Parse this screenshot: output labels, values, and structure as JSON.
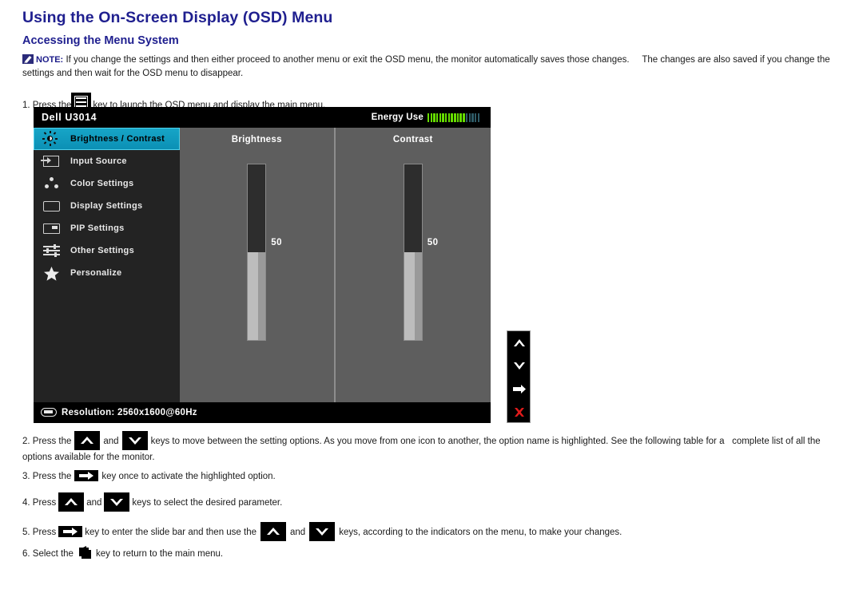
{
  "page": {
    "title": "Using the On-Screen Display (OSD) Menu",
    "subtitle": "Accessing the Menu System"
  },
  "note": {
    "icon": "note-pencil-icon",
    "label": "NOTE:",
    "text_part1": "If you change the settings and then either proceed to another menu or exit the OSD menu, the monitor automatically saves those changes.",
    "text_part2": "The changes are also saved if you change the",
    "text_line2": "settings and then wait for the OSD menu to disappear."
  },
  "steps": [
    {
      "number": "1.",
      "before": "Press the",
      "key": "menu-key-icon",
      "after": "key to launch the OSD menu and display the main menu."
    },
    {
      "number": "2.",
      "before": "Press the",
      "key1": "up-arrow-key-icon",
      "mid": "and",
      "key2": "down-arrow-key-icon",
      "after": "keys to move between the setting options. As you move from one icon to another, the option name is highlighted. See the following table for a",
      "after2": "complete list of all the",
      "line2": "options available for the monitor."
    },
    {
      "number": "3.",
      "before": "Press the",
      "key": "right-arrow-key-icon",
      "after": "key once to activate the highlighted option."
    },
    {
      "number": "4.",
      "before": "Press",
      "key1": "up-arrow-key-icon",
      "mid": "and",
      "key2": "down-arrow-key-icon",
      "after": "keys to select the desired parameter."
    },
    {
      "number": "5.",
      "before": "Press",
      "key1": "right-arrow-key-icon",
      "mid1": "key to enter the slide bar and then use the",
      "key2": "up-arrow-key-icon",
      "mid2": "and",
      "key3": "down-arrow-key-icon",
      "after": "keys, according to the indicators on the menu, to make your changes."
    },
    {
      "number": "6.",
      "before": "Select the",
      "key": "back-key-icon",
      "after": "key to return to the main menu."
    }
  ],
  "osd": {
    "model": "Dell U3014",
    "energy": {
      "label": "Energy Use",
      "bars_lit": 13,
      "bars_unlit": 5,
      "lit_color": "#66dd00",
      "unlit_color": "#2e5a66"
    },
    "menu_items": [
      {
        "icon": "brightness-contrast-icon",
        "label": "Brightness / Contrast",
        "active": true
      },
      {
        "icon": "input-source-icon",
        "label": "Input Source",
        "active": false
      },
      {
        "icon": "color-settings-icon",
        "label": "Color Settings",
        "active": false
      },
      {
        "icon": "display-settings-icon",
        "label": "Display Settings",
        "active": false
      },
      {
        "icon": "pip-settings-icon",
        "label": "PIP Settings",
        "active": false
      },
      {
        "icon": "other-settings-icon",
        "label": "Other Settings",
        "active": false
      },
      {
        "icon": "personalize-icon",
        "label": "Personalize",
        "active": false
      }
    ],
    "panes": [
      {
        "title": "Brightness",
        "value": "50",
        "percent": 50
      },
      {
        "title": "Contrast",
        "value": "50",
        "percent": 50
      }
    ],
    "footer": {
      "icon": "resolution-icon",
      "text": "Resolution: 2560x1600@60Hz"
    },
    "nav_keys": [
      {
        "icon": "up-arrow-icon",
        "color": "#ffffff"
      },
      {
        "icon": "down-arrow-icon",
        "color": "#ffffff"
      },
      {
        "icon": "right-arrow-icon",
        "color": "#ffffff"
      },
      {
        "icon": "close-x-icon",
        "color": "#e01b1b"
      }
    ],
    "highlight_color": "#0b9cc4"
  }
}
